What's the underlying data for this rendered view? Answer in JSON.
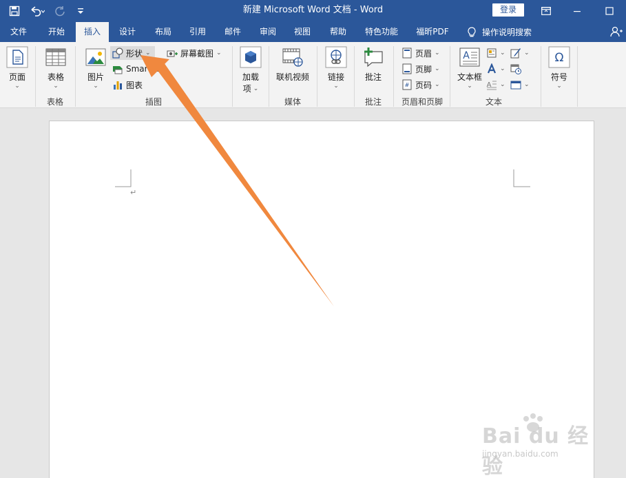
{
  "window": {
    "title": "新建 Microsoft Word 文档  -  Word",
    "login_label": "登录",
    "colors": {
      "titlebar": "#2b579a",
      "ribbon": "#f3f3f3",
      "arrow": "#f0883e"
    }
  },
  "tabs": [
    {
      "label": "文件"
    },
    {
      "label": "开始"
    },
    {
      "label": "插入",
      "active": true
    },
    {
      "label": "设计"
    },
    {
      "label": "布局"
    },
    {
      "label": "引用"
    },
    {
      "label": "邮件"
    },
    {
      "label": "审阅"
    },
    {
      "label": "视图"
    },
    {
      "label": "帮助"
    },
    {
      "label": "特色功能"
    },
    {
      "label": "福昕PDF"
    }
  ],
  "tell_me": {
    "label": "操作说明搜索",
    "icon": "lightbulb-icon"
  },
  "ribbon": {
    "pages": {
      "button": "页面",
      "icon": "page-icon"
    },
    "tables": {
      "button": "表格",
      "group": "表格",
      "icon": "table-icon"
    },
    "illustrations": {
      "group": "插图",
      "pictures": "图片",
      "shapes": "形状",
      "smartart": "SmartArt",
      "chart": "图表",
      "screenshot": "屏幕截图"
    },
    "addins": {
      "button_line1": "加载",
      "button_line2": "项"
    },
    "media": {
      "button": "联机视频",
      "group": "媒体"
    },
    "links": {
      "button": "链接"
    },
    "comments": {
      "button": "批注",
      "group": "批注"
    },
    "header_footer": {
      "header": "页眉",
      "footer": "页脚",
      "page_number": "页码",
      "group": "页眉和页脚"
    },
    "text": {
      "textbox": "文本框",
      "group": "文本"
    },
    "symbols": {
      "button": "符号"
    }
  },
  "document": {
    "paragraph_mark": "↵"
  },
  "watermark": {
    "main": "Bai du 经验",
    "sub": "jingyan.baidu.com"
  }
}
